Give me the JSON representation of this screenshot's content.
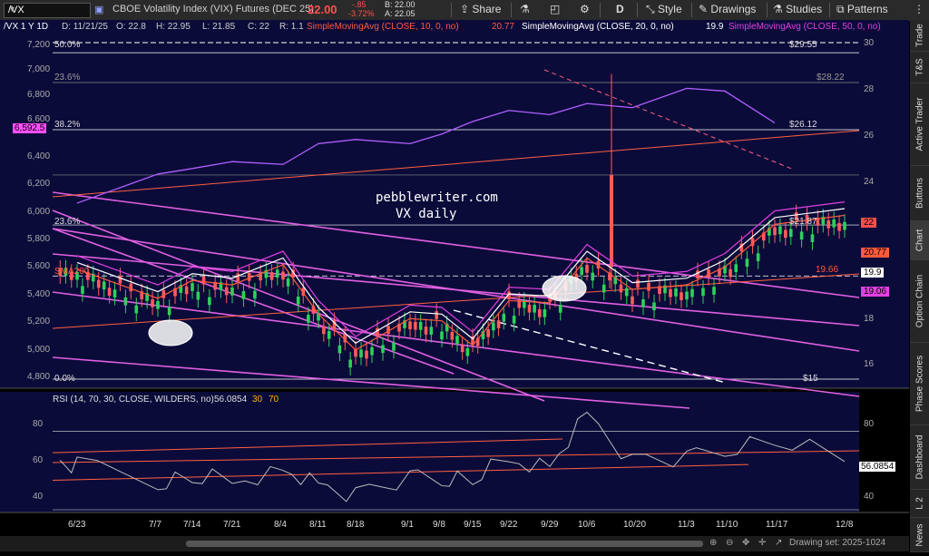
{
  "toolbar": {
    "symbol": "/VX",
    "instrument_name": "CBOE Volatility Index (VIX) Futures (DEC 25)",
    "last_price": "22.00",
    "change_abs": "-.85",
    "change_pct": "-3.72%",
    "bid": "B: 22.00",
    "ask": "A: 22.05",
    "share_label": "Share",
    "period_label": "D",
    "style_label": "Style",
    "drawings_label": "Drawings",
    "studies_label": "Studies",
    "patterns_label": "Patterns"
  },
  "info_bar": {
    "ticker": "/VX 1 Y 1D",
    "date": "D: 11/21/25",
    "open": "O: 22.8",
    "high": "H: 22.95",
    "low": "L: 21.85",
    "close": "C: 22",
    "range": "R: 1.1",
    "sma10_label": "SimpleMovingAvg (CLOSE, 10, 0, no)",
    "sma10_value": "20.77",
    "sma20_label": "SimpleMovingAvg (CLOSE, 20, 0, no)",
    "sma20_value": "19.9",
    "sma50_label": "SimpleMovingAvg (CLOSE, 50, 0, no)"
  },
  "annotations": {
    "watermark_line1": "pebblewriter.com",
    "watermark_line2": "VX daily",
    "sma200_label": "SMA200"
  },
  "fib": [
    {
      "pct": "50.0%",
      "price": "$29.55"
    },
    {
      "pct": "23.6%",
      "price": "$28.22"
    },
    {
      "pct": "38.2%",
      "price": "$26.12"
    },
    {
      "pct": "23.6%",
      "price": "$21.87"
    },
    {
      "pct": "0.0%",
      "price": "$15"
    }
  ],
  "right_axis": {
    "ticks": [
      "30",
      "28",
      "26",
      "24",
      "22",
      "20",
      "18",
      "16"
    ],
    "badges": [
      {
        "value": "22",
        "color": "#ff4d4d"
      },
      {
        "value": "20.77",
        "color": "#ff5a3c"
      },
      {
        "value": "19.66",
        "color": "#ff5a3c"
      },
      {
        "value": "19.9",
        "color": "#ffffff"
      },
      {
        "value": "19.06",
        "color": "#e040e0"
      }
    ]
  },
  "left_axis": {
    "ticks": [
      "7,200",
      "7,000",
      "6,800",
      "6,600",
      "6,400",
      "6,200",
      "6,000",
      "5,800",
      "5,600",
      "5,400",
      "5,200",
      "5,000",
      "4,800"
    ],
    "badge": "6,592.5"
  },
  "rsi": {
    "label": "RSI (14, 70, 30, CLOSE, WILDERS, no)",
    "value": "56.0854",
    "level_low": "30",
    "level_high": "70",
    "ticks": [
      "80",
      "60",
      "40"
    ],
    "right_value": "56.0854"
  },
  "date_axis": [
    "6/23",
    "7/7",
    "7/14",
    "7/21",
    "8/4",
    "8/11",
    "8/18",
    "9/1",
    "9/8",
    "9/15",
    "9/22",
    "9/29",
    "10/6",
    "10/20",
    "11/3",
    "11/10",
    "11/17",
    "12/8"
  ],
  "status": {
    "drawing_set": "Drawing set: 2025-1024"
  },
  "sidebar_tabs": [
    "Trade",
    "T&S",
    "Active Trader",
    "Buttons",
    "Chart",
    "Option Chain",
    "Phase Scores",
    "Dashboard",
    "L 2",
    "News"
  ],
  "colors": {
    "chart_bg": "#0b0b3a",
    "up_candle": "#2ed15a",
    "down_candle": "#ff5c5c",
    "sma10": "#ff5a3c",
    "sma20": "#ffffff",
    "sma50": "#e040e0",
    "spx_line": "#b060ff"
  },
  "chart_data": {
    "type": "candlestick",
    "x_range": [
      "6/16",
      "12/8"
    ],
    "y_range_right": [
      15,
      30
    ],
    "y_range_left": [
      4750,
      7300
    ],
    "series": [
      {
        "name": "/VX close (approx)",
        "x": [
          "6/23",
          "7/7",
          "7/14",
          "7/21",
          "8/4",
          "8/11",
          "8/18",
          "9/1",
          "9/8",
          "9/15",
          "9/22",
          "9/29",
          "10/6",
          "10/20",
          "11/3",
          "11/10",
          "11/17",
          "11/21"
        ],
        "values": [
          19.6,
          18.3,
          19.1,
          18.9,
          19.8,
          17.6,
          16.0,
          17.4,
          17.3,
          16.2,
          18.2,
          18.1,
          20.1,
          18.7,
          18.9,
          19.7,
          21.6,
          22.0
        ]
      },
      {
        "name": "S&P 500 (left axis, approx)",
        "x": [
          "6/23",
          "7/7",
          "7/14",
          "7/21",
          "8/4",
          "8/11",
          "8/18",
          "9/1",
          "9/8",
          "9/15",
          "9/22",
          "9/29",
          "10/6",
          "10/20",
          "11/3",
          "11/10",
          "11/17"
        ],
        "values": [
          6020,
          6230,
          6270,
          6320,
          6300,
          6450,
          6480,
          6450,
          6520,
          6610,
          6690,
          6660,
          6740,
          6710,
          6850,
          6830,
          6600
        ]
      },
      {
        "name": "RSI",
        "x": [
          "6/23",
          "7/7",
          "7/14",
          "7/21",
          "8/4",
          "8/11",
          "8/18",
          "9/1",
          "9/8",
          "9/15",
          "9/22",
          "9/29",
          "10/6",
          "10/20",
          "11/3",
          "11/10",
          "11/17",
          "11/21"
        ],
        "values": [
          52,
          45,
          47,
          45,
          50,
          42,
          38,
          45,
          47,
          46,
          56,
          52,
          78,
          55,
          55,
          62,
          66,
          56.0854
        ]
      }
    ]
  }
}
